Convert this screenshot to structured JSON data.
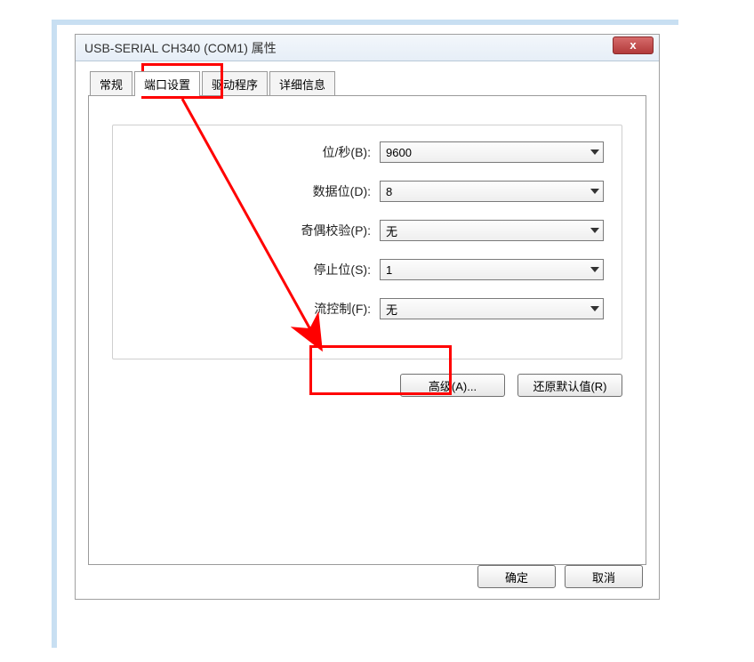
{
  "window": {
    "title": "USB-SERIAL CH340 (COM1) 属性",
    "close_symbol": "x"
  },
  "tabs": {
    "items": [
      {
        "label": "常规"
      },
      {
        "label": "端口设置"
      },
      {
        "label": "驱动程序"
      },
      {
        "label": "详细信息"
      }
    ],
    "active_index": 1
  },
  "port_settings": {
    "rows": [
      {
        "label": "位/秒(B):",
        "value": "9600"
      },
      {
        "label": "数据位(D):",
        "value": "8"
      },
      {
        "label": "奇偶校验(P):",
        "value": "无"
      },
      {
        "label": "停止位(S):",
        "value": "1"
      },
      {
        "label": "流控制(F):",
        "value": "无"
      }
    ],
    "advanced_label": "高级(A)...",
    "restore_label": "还原默认值(R)"
  },
  "footer": {
    "ok_label": "确定",
    "cancel_label": "取消"
  }
}
